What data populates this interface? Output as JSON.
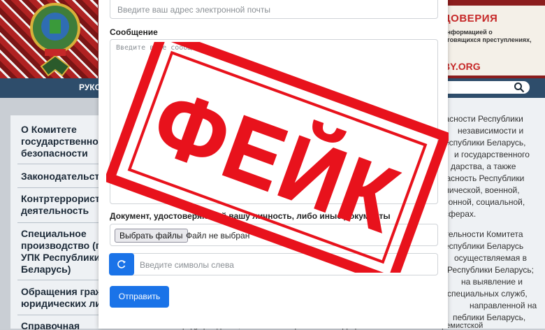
{
  "banner": {
    "title": "ДОВЕРИЯ",
    "line1": "информацией о",
    "line2": "отовящихся преступлениях,",
    "site": "BY.ORG"
  },
  "navbar": {
    "fragment": "РУКО"
  },
  "sidebar": {
    "items": [
      {
        "label": "О Комитете\nгосударственно\nбезопасности"
      },
      {
        "label": "Законодательст"
      },
      {
        "label": "Контртеррорист\nдеятельность"
      },
      {
        "label": "Специальное\nпроизводство (п\nУПК Республики\nБеларусь)"
      },
      {
        "label": "Обращения граж\nюридических ли"
      },
      {
        "label": "Справочная информация"
      }
    ]
  },
  "article": {
    "lines": [
      "пасности Республики",
      "независимости и",
      "еспублики Беларусь,",
      "и государственного",
      "дарства, а также",
      "пасность Республики",
      "омической, военной,",
      "ционной, социальной,",
      "сферах.",
      "ятельности Комитета",
      "еспублики Беларусь",
      "осуществляемая в",
      "Республики Беларусь;",
      "на выявление и",
      "специальных служб,",
      "направленной на",
      "пеблики Беларусь,",
      "предупреждение, выявление и пресечение террористической и иной экстремистской"
    ]
  },
  "form": {
    "email_placeholder": "Введите ваш адрес электронной почты",
    "message_label": "Сообщение",
    "message_placeholder": "Введите ваше сообщение",
    "document_label": "Документ, удостоверяющий вашу личность, либо иные документы",
    "file_button": "Выбрать файлы",
    "file_status": "Файл не выбран",
    "captcha_placeholder": "Введите символы слева",
    "submit_label": "Отправить"
  },
  "stamp": {
    "text": "ФЕЙК",
    "color": "#e8121c"
  },
  "colors": {
    "primary": "#1a73e8",
    "header": "#8b1d1d",
    "navbar": "#2e4d6b"
  },
  "icons": {
    "refresh": "refresh-icon",
    "search": "search-icon",
    "emblem": "emblem-icon"
  }
}
